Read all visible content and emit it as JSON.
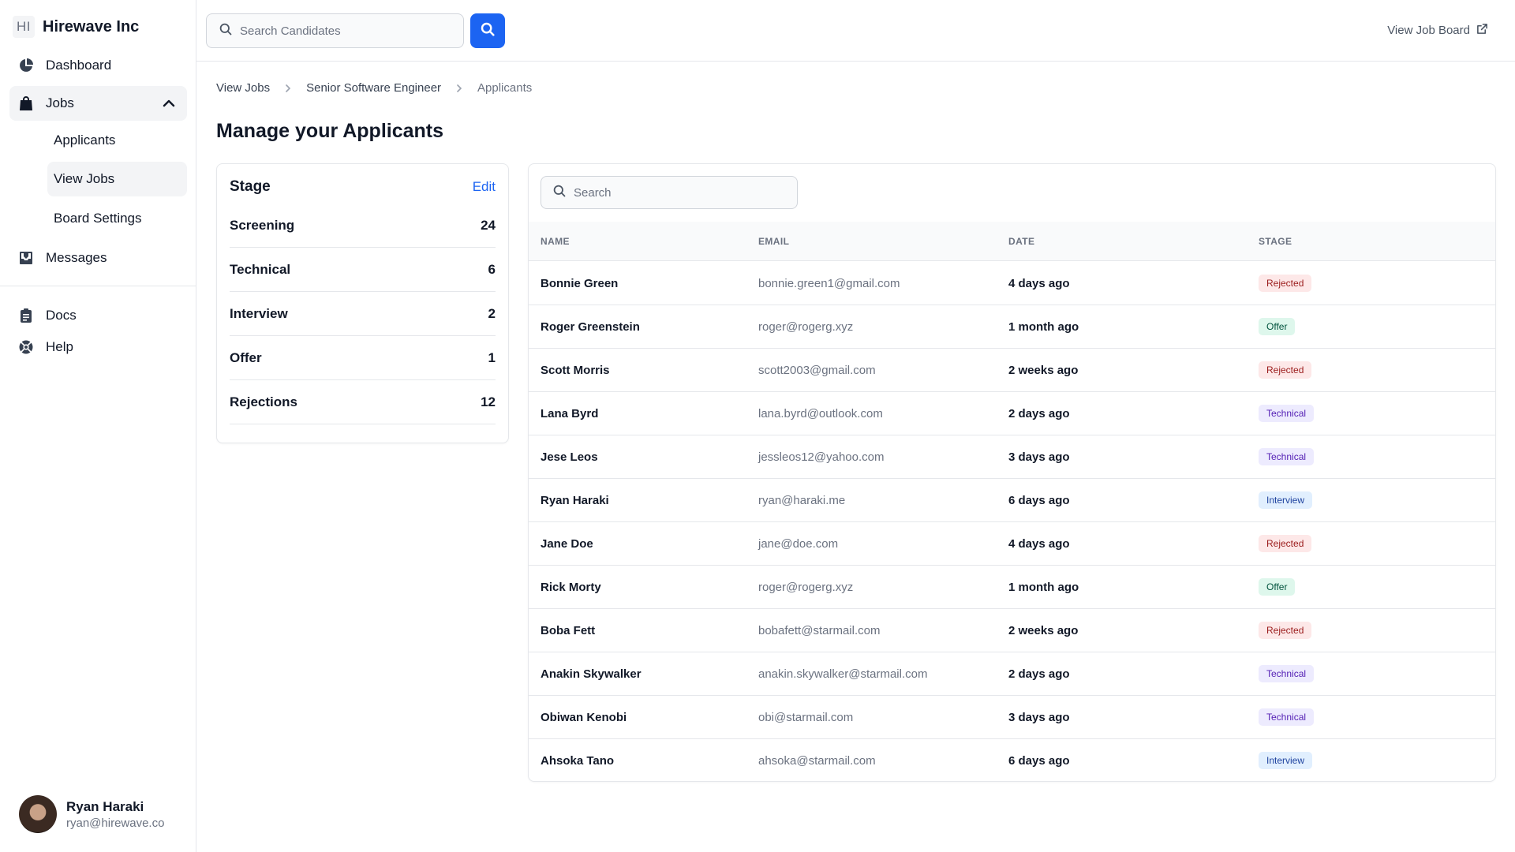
{
  "brand": {
    "mark": "HI",
    "name": "Hirewave Inc"
  },
  "sidebar": {
    "dashboard": "Dashboard",
    "jobs": "Jobs",
    "jobs_children": [
      "Applicants",
      "View Jobs",
      "Board Settings"
    ],
    "messages": "Messages",
    "docs": "Docs",
    "help": "Help"
  },
  "user": {
    "name": "Ryan Haraki",
    "email": "ryan@hirewave.co"
  },
  "topbar": {
    "search_placeholder": "Search Candidates",
    "view_board": "View Job Board"
  },
  "breadcrumb": [
    "View Jobs",
    "Senior Software Engineer",
    "Applicants"
  ],
  "page_title": "Manage your Applicants",
  "stages": {
    "title": "Stage",
    "edit": "Edit",
    "items": [
      {
        "name": "Screening",
        "count": "24"
      },
      {
        "name": "Technical",
        "count": "6"
      },
      {
        "name": "Interview",
        "count": "2"
      },
      {
        "name": "Offer",
        "count": "1"
      },
      {
        "name": "Rejections",
        "count": "12"
      }
    ]
  },
  "table": {
    "search_placeholder": "Search",
    "columns": [
      "NAME",
      "EMAIL",
      "DATE",
      "STAGE"
    ],
    "rows": [
      {
        "name": "Bonnie Green",
        "email": "bonnie.green1@gmail.com",
        "date": "4 days ago",
        "stage": "Rejected"
      },
      {
        "name": "Roger Greenstein",
        "email": "roger@rogerg.xyz",
        "date": "1 month ago",
        "stage": "Offer"
      },
      {
        "name": "Scott Morris",
        "email": "scott2003@gmail.com",
        "date": "2 weeks ago",
        "stage": "Rejected"
      },
      {
        "name": "Lana Byrd",
        "email": "lana.byrd@outlook.com",
        "date": "2 days ago",
        "stage": "Technical"
      },
      {
        "name": "Jese Leos",
        "email": "jessleos12@yahoo.com",
        "date": "3 days ago",
        "stage": "Technical"
      },
      {
        "name": "Ryan Haraki",
        "email": "ryan@haraki.me",
        "date": "6 days ago",
        "stage": "Interview"
      },
      {
        "name": "Jane Doe",
        "email": "jane@doe.com",
        "date": "4 days ago",
        "stage": "Rejected"
      },
      {
        "name": "Rick Morty",
        "email": "roger@rogerg.xyz",
        "date": "1 month ago",
        "stage": "Offer"
      },
      {
        "name": "Boba Fett",
        "email": "bobafett@starmail.com",
        "date": "2 weeks ago",
        "stage": "Rejected"
      },
      {
        "name": "Anakin Skywalker",
        "email": "anakin.skywalker@starmail.com",
        "date": "2 days ago",
        "stage": "Technical"
      },
      {
        "name": "Obiwan Kenobi",
        "email": "obi@starmail.com",
        "date": "3 days ago",
        "stage": "Technical"
      },
      {
        "name": "Ahsoka Tano",
        "email": "ahsoka@starmail.com",
        "date": "6 days ago",
        "stage": "Interview"
      }
    ]
  },
  "stage_colors": {
    "Rejected": {
      "bg": "#fde8e8",
      "fg": "#9b1c1c"
    },
    "Offer": {
      "bg": "#def7ec",
      "fg": "#03543f"
    },
    "Technical": {
      "bg": "#edebfe",
      "fg": "#5521b5"
    },
    "Interview": {
      "bg": "#e1effe",
      "fg": "#1e429f"
    }
  },
  "accent": "#1c64f2"
}
